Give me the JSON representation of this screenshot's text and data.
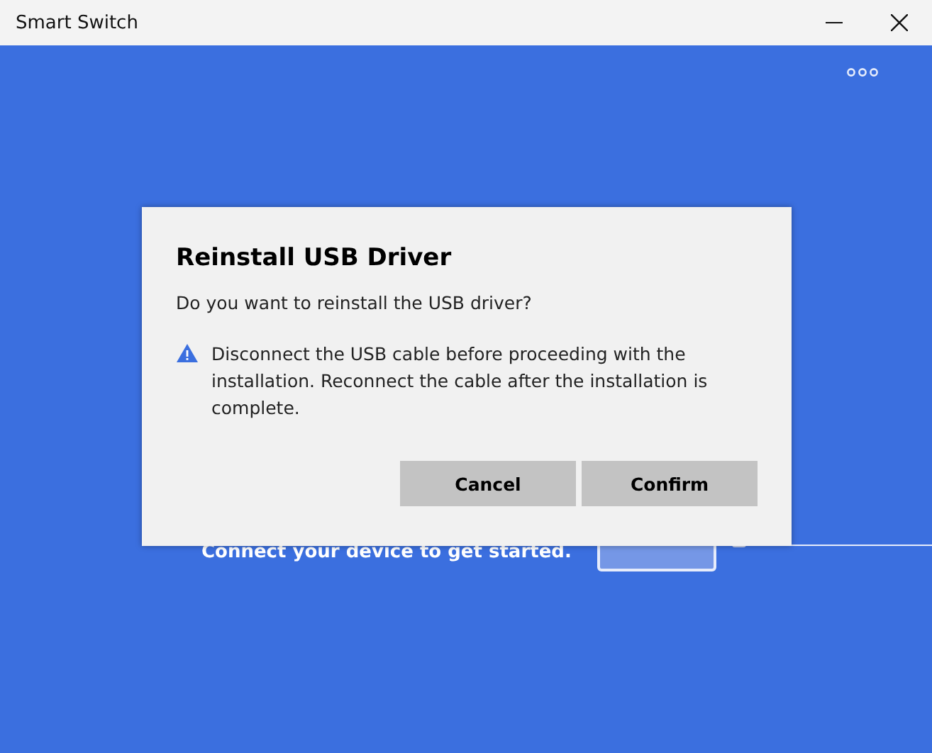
{
  "window": {
    "title": "Smart Switch"
  },
  "background": {
    "message": "Connect your device to get started."
  },
  "dialog": {
    "title": "Reinstall USB Driver",
    "question": "Do you want to reinstall the USB driver?",
    "warning": "Disconnect the USB cable before proceeding with the installation. Reconnect the cable after the installation is complete.",
    "buttons": [
      {
        "label": "Cancel"
      },
      {
        "label": "Confirm"
      }
    ]
  }
}
